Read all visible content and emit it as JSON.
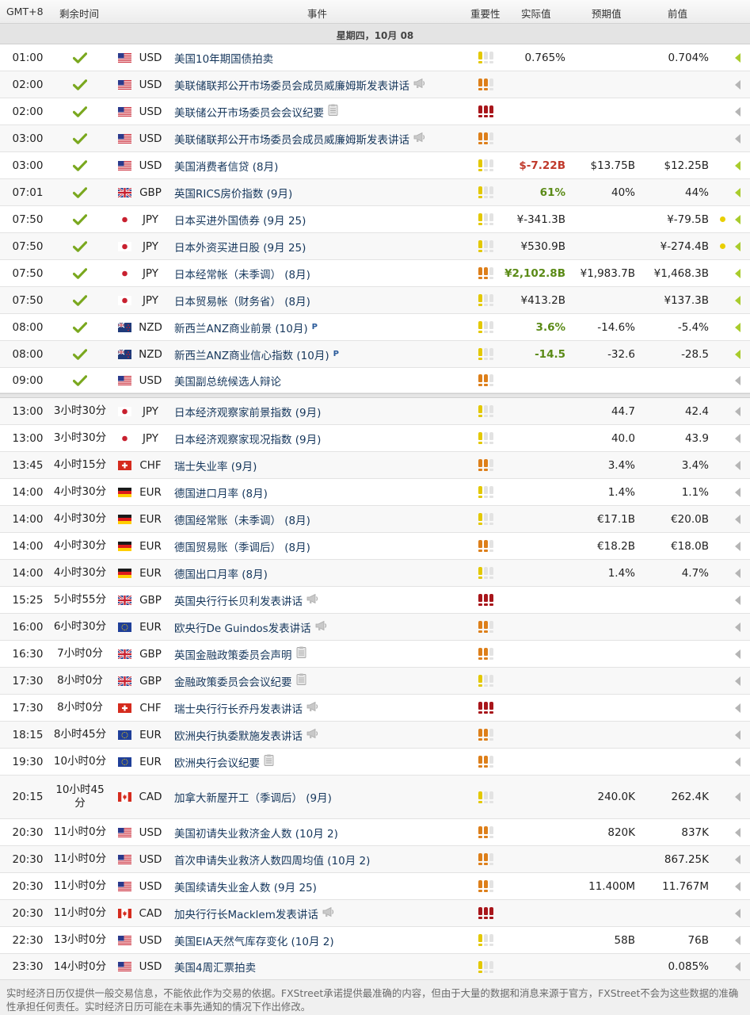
{
  "header": {
    "timezone": "GMT+8",
    "remaining": "剩余时间",
    "event": "事件",
    "importance": "重要性",
    "actual": "实际值",
    "forecast": "预期值",
    "previous": "前值"
  },
  "date_label": "星期四，10月 08",
  "colors": {
    "importance_low": "#e3c800",
    "importance_medium": "#dd7f1a",
    "importance_high": "#a8161b",
    "actual_negative": "#c0392b",
    "actual_positive": "#5a8a16",
    "event_link": "#16375c"
  },
  "events": [
    {
      "time": "01:00",
      "remaining": "",
      "status": "check-icon",
      "flag": "us-flag-icon",
      "currency": "USD",
      "event": "美国10年期国债拍卖",
      "icon": "",
      "importance": 1,
      "actual": "0.765%",
      "actual_color": "",
      "forecast": "",
      "previous": "0.704%",
      "revised": false,
      "arrow": "green"
    },
    {
      "time": "02:00",
      "remaining": "",
      "status": "check-icon",
      "flag": "us-flag-icon",
      "currency": "USD",
      "event": "美联储联邦公开市场委员会成员威廉姆斯发表讲话",
      "icon": "megaphone-icon",
      "importance": 2,
      "actual": "",
      "actual_color": "",
      "forecast": "",
      "previous": "",
      "revised": false,
      "arrow": "grey"
    },
    {
      "time": "02:00",
      "remaining": "",
      "status": "check-icon",
      "flag": "us-flag-icon",
      "currency": "USD",
      "event": "美联储公开市场委员会会议纪要",
      "icon": "document-icon",
      "importance": 3,
      "actual": "",
      "actual_color": "",
      "forecast": "",
      "previous": "",
      "revised": false,
      "arrow": "grey"
    },
    {
      "time": "03:00",
      "remaining": "",
      "status": "check-icon",
      "flag": "us-flag-icon",
      "currency": "USD",
      "event": "美联储联邦公开市场委员会成员威廉姆斯发表讲话",
      "icon": "megaphone-icon",
      "importance": 2,
      "actual": "",
      "actual_color": "",
      "forecast": "",
      "previous": "",
      "revised": false,
      "arrow": "grey"
    },
    {
      "time": "03:00",
      "remaining": "",
      "status": "check-icon",
      "flag": "us-flag-icon",
      "currency": "USD",
      "event": "美国消费者信贷 (8月)",
      "icon": "",
      "importance": 1,
      "actual": "$-7.22B",
      "actual_color": "red",
      "forecast": "$13.75B",
      "previous": "$12.25B",
      "revised": false,
      "arrow": "green"
    },
    {
      "time": "07:01",
      "remaining": "",
      "status": "check-icon",
      "flag": "gb-flag-icon",
      "currency": "GBP",
      "event": "英国RICS房价指数 (9月)",
      "icon": "",
      "importance": 1,
      "actual": "61%",
      "actual_color": "green",
      "forecast": "40%",
      "previous": "44%",
      "revised": false,
      "arrow": "green"
    },
    {
      "time": "07:50",
      "remaining": "",
      "status": "check-icon",
      "flag": "jp-flag-icon",
      "currency": "JPY",
      "event": "日本买进外国债券 (9月 25)",
      "icon": "",
      "importance": 1,
      "actual": "¥-341.3B",
      "actual_color": "",
      "forecast": "",
      "previous": "¥-79.5B",
      "revised": true,
      "arrow": "green"
    },
    {
      "time": "07:50",
      "remaining": "",
      "status": "check-icon",
      "flag": "jp-flag-icon",
      "currency": "JPY",
      "event": "日本外资买进日股 (9月 25)",
      "icon": "",
      "importance": 1,
      "actual": "¥530.9B",
      "actual_color": "",
      "forecast": "",
      "previous": "¥-274.4B",
      "revised": true,
      "arrow": "green"
    },
    {
      "time": "07:50",
      "remaining": "",
      "status": "check-icon",
      "flag": "jp-flag-icon",
      "currency": "JPY",
      "event": "日本经常帐（未季调） (8月)",
      "icon": "",
      "importance": 2,
      "actual": "¥2,102.8B",
      "actual_color": "green",
      "forecast": "¥1,983.7B",
      "previous": "¥1,468.3B",
      "revised": false,
      "arrow": "green"
    },
    {
      "time": "07:50",
      "remaining": "",
      "status": "check-icon",
      "flag": "jp-flag-icon",
      "currency": "JPY",
      "event": "日本贸易帐（财务省） (8月)",
      "icon": "",
      "importance": 1,
      "actual": "¥413.2B",
      "actual_color": "",
      "forecast": "",
      "previous": "¥137.3B",
      "revised": false,
      "arrow": "green"
    },
    {
      "time": "08:00",
      "remaining": "",
      "status": "check-icon",
      "flag": "nz-flag-icon",
      "currency": "NZD",
      "event": "新西兰ANZ商业前景 (10月)",
      "icon": "preliminary-icon",
      "importance": 1,
      "actual": "3.6%",
      "actual_color": "green",
      "forecast": "-14.6%",
      "previous": "-5.4%",
      "revised": false,
      "arrow": "green"
    },
    {
      "time": "08:00",
      "remaining": "",
      "status": "check-icon",
      "flag": "nz-flag-icon",
      "currency": "NZD",
      "event": "新西兰ANZ商业信心指数 (10月)",
      "icon": "preliminary-icon",
      "importance": 1,
      "actual": "-14.5",
      "actual_color": "green",
      "forecast": "-32.6",
      "previous": "-28.5",
      "revised": false,
      "arrow": "green"
    },
    {
      "time": "09:00",
      "remaining": "",
      "status": "check-icon",
      "flag": "us-flag-icon",
      "currency": "USD",
      "event": "美国副总统候选人辩论",
      "icon": "",
      "importance": 2,
      "actual": "",
      "actual_color": "",
      "forecast": "",
      "previous": "",
      "revised": false,
      "arrow": "grey"
    },
    {
      "time": "13:00",
      "remaining": "3小时30分",
      "status": "",
      "flag": "jp-flag-icon",
      "currency": "JPY",
      "event": "日本经济观察家前景指数 (9月)",
      "icon": "",
      "importance": 1,
      "actual": "",
      "actual_color": "",
      "forecast": "44.7",
      "previous": "42.4",
      "revised": false,
      "arrow": "grey"
    },
    {
      "time": "13:00",
      "remaining": "3小时30分",
      "status": "",
      "flag": "jp-flag-icon",
      "currency": "JPY",
      "event": "日本经济观察家现况指数 (9月)",
      "icon": "",
      "importance": 1,
      "actual": "",
      "actual_color": "",
      "forecast": "40.0",
      "previous": "43.9",
      "revised": false,
      "arrow": "grey"
    },
    {
      "time": "13:45",
      "remaining": "4小时15分",
      "status": "",
      "flag": "ch-flag-icon",
      "currency": "CHF",
      "event": "瑞士失业率 (9月)",
      "icon": "",
      "importance": 2,
      "actual": "",
      "actual_color": "",
      "forecast": "3.4%",
      "previous": "3.4%",
      "revised": false,
      "arrow": "grey"
    },
    {
      "time": "14:00",
      "remaining": "4小时30分",
      "status": "",
      "flag": "de-flag-icon",
      "currency": "EUR",
      "event": "德国进口月率 (8月)",
      "icon": "",
      "importance": 1,
      "actual": "",
      "actual_color": "",
      "forecast": "1.4%",
      "previous": "1.1%",
      "revised": false,
      "arrow": "grey"
    },
    {
      "time": "14:00",
      "remaining": "4小时30分",
      "status": "",
      "flag": "de-flag-icon",
      "currency": "EUR",
      "event": "德国经常账（未季调） (8月)",
      "icon": "",
      "importance": 1,
      "actual": "",
      "actual_color": "",
      "forecast": "€17.1B",
      "previous": "€20.0B",
      "revised": false,
      "arrow": "grey"
    },
    {
      "time": "14:00",
      "remaining": "4小时30分",
      "status": "",
      "flag": "de-flag-icon",
      "currency": "EUR",
      "event": "德国贸易账（季调后） (8月)",
      "icon": "",
      "importance": 2,
      "actual": "",
      "actual_color": "",
      "forecast": "€18.2B",
      "previous": "€18.0B",
      "revised": false,
      "arrow": "grey"
    },
    {
      "time": "14:00",
      "remaining": "4小时30分",
      "status": "",
      "flag": "de-flag-icon",
      "currency": "EUR",
      "event": "德国出口月率 (8月)",
      "icon": "",
      "importance": 1,
      "actual": "",
      "actual_color": "",
      "forecast": "1.4%",
      "previous": "4.7%",
      "revised": false,
      "arrow": "grey"
    },
    {
      "time": "15:25",
      "remaining": "5小时55分",
      "status": "",
      "flag": "gb-flag-icon",
      "currency": "GBP",
      "event": "英国央行行长贝利发表讲话",
      "icon": "megaphone-icon",
      "importance": 3,
      "actual": "",
      "actual_color": "",
      "forecast": "",
      "previous": "",
      "revised": false,
      "arrow": "grey"
    },
    {
      "time": "16:00",
      "remaining": "6小时30分",
      "status": "",
      "flag": "eu-flag-icon",
      "currency": "EUR",
      "event": "欧央行De Guindos发表讲话",
      "icon": "megaphone-icon",
      "importance": 2,
      "actual": "",
      "actual_color": "",
      "forecast": "",
      "previous": "",
      "revised": false,
      "arrow": "grey"
    },
    {
      "time": "16:30",
      "remaining": "7小时0分",
      "status": "",
      "flag": "gb-flag-icon",
      "currency": "GBP",
      "event": "英国金融政策委员会声明",
      "icon": "document-icon",
      "importance": 2,
      "actual": "",
      "actual_color": "",
      "forecast": "",
      "previous": "",
      "revised": false,
      "arrow": "grey"
    },
    {
      "time": "17:30",
      "remaining": "8小时0分",
      "status": "",
      "flag": "gb-flag-icon",
      "currency": "GBP",
      "event": "金融政策委员会会议纪要",
      "icon": "document-icon",
      "importance": 1,
      "actual": "",
      "actual_color": "",
      "forecast": "",
      "previous": "",
      "revised": false,
      "arrow": "grey"
    },
    {
      "time": "17:30",
      "remaining": "8小时0分",
      "status": "",
      "flag": "ch-flag-icon",
      "currency": "CHF",
      "event": "瑞士央行行长乔丹发表讲话",
      "icon": "megaphone-icon",
      "importance": 3,
      "actual": "",
      "actual_color": "",
      "forecast": "",
      "previous": "",
      "revised": false,
      "arrow": "grey"
    },
    {
      "time": "18:15",
      "remaining": "8小时45分",
      "status": "",
      "flag": "eu-flag-icon",
      "currency": "EUR",
      "event": "欧洲央行执委默施发表讲话",
      "icon": "megaphone-icon",
      "importance": 2,
      "actual": "",
      "actual_color": "",
      "forecast": "",
      "previous": "",
      "revised": false,
      "arrow": "grey"
    },
    {
      "time": "19:30",
      "remaining": "10小时0分",
      "status": "",
      "flag": "eu-flag-icon",
      "currency": "EUR",
      "event": "欧洲央行会议纪要",
      "icon": "document-icon",
      "importance": 2,
      "actual": "",
      "actual_color": "",
      "forecast": "",
      "previous": "",
      "revised": false,
      "arrow": "grey"
    },
    {
      "time": "20:15",
      "remaining": "10小时45分",
      "status": "",
      "flag": "ca-flag-icon",
      "currency": "CAD",
      "event": "加拿大新屋开工（季调后） (9月)",
      "icon": "",
      "importance": 1,
      "actual": "",
      "actual_color": "",
      "forecast": "240.0K",
      "previous": "262.4K",
      "revised": false,
      "arrow": "grey"
    },
    {
      "time": "20:30",
      "remaining": "11小时0分",
      "status": "",
      "flag": "us-flag-icon",
      "currency": "USD",
      "event": "美国初请失业救济金人数 (10月 2)",
      "icon": "",
      "importance": 2,
      "actual": "",
      "actual_color": "",
      "forecast": "820K",
      "previous": "837K",
      "revised": false,
      "arrow": "grey"
    },
    {
      "time": "20:30",
      "remaining": "11小时0分",
      "status": "",
      "flag": "us-flag-icon",
      "currency": "USD",
      "event": "首次申请失业救济人数四周均值 (10月 2)",
      "icon": "",
      "importance": 2,
      "actual": "",
      "actual_color": "",
      "forecast": "",
      "previous": "867.25K",
      "revised": false,
      "arrow": "grey"
    },
    {
      "time": "20:30",
      "remaining": "11小时0分",
      "status": "",
      "flag": "us-flag-icon",
      "currency": "USD",
      "event": "美国续请失业金人数 (9月 25)",
      "icon": "",
      "importance": 2,
      "actual": "",
      "actual_color": "",
      "forecast": "11.400M",
      "previous": "11.767M",
      "revised": false,
      "arrow": "grey"
    },
    {
      "time": "20:30",
      "remaining": "11小时0分",
      "status": "",
      "flag": "ca-flag-icon",
      "currency": "CAD",
      "event": "加央行行长Macklem发表讲话",
      "icon": "megaphone-icon",
      "importance": 3,
      "actual": "",
      "actual_color": "",
      "forecast": "",
      "previous": "",
      "revised": false,
      "arrow": "grey"
    },
    {
      "time": "22:30",
      "remaining": "13小时0分",
      "status": "",
      "flag": "us-flag-icon",
      "currency": "USD",
      "event": "美国EIA天然气库存变化 (10月 2)",
      "icon": "",
      "importance": 1,
      "actual": "",
      "actual_color": "",
      "forecast": "58B",
      "previous": "76B",
      "revised": false,
      "arrow": "grey"
    },
    {
      "time": "23:30",
      "remaining": "14小时0分",
      "status": "",
      "flag": "us-flag-icon",
      "currency": "USD",
      "event": "美国4周汇票拍卖",
      "icon": "",
      "importance": 1,
      "actual": "",
      "actual_color": "",
      "forecast": "",
      "previous": "0.085%",
      "revised": false,
      "arrow": "grey"
    }
  ],
  "preliminary_tag": "P",
  "footer": {
    "disclaimer": "实时经济日历仅提供一般交易信息，不能依此作为交易的依据。FXStreet承诺提供最准确的内容，但由于大量的数据和消息来源于官方，FXStreet不会为这些数据的准确性承担任何责任。实时经济日历可能在未事先通知的情况下作出修改。"
  }
}
